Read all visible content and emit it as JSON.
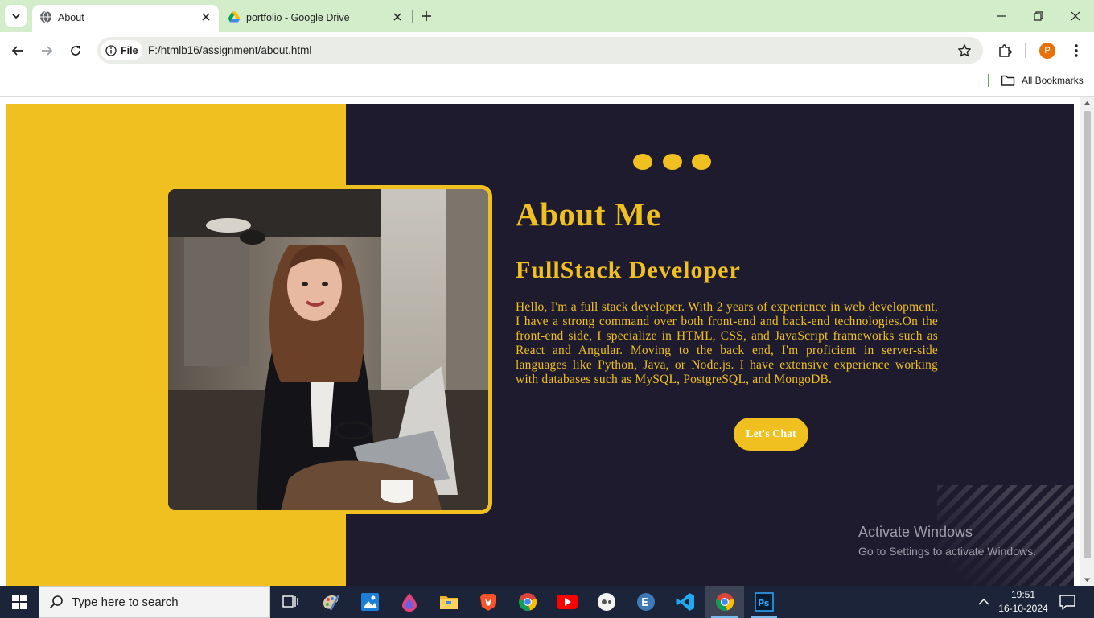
{
  "browser": {
    "tabs": [
      {
        "title": "About",
        "active": true
      },
      {
        "title": "portfolio - Google Drive",
        "active": false
      }
    ],
    "address": {
      "security_chip": "File",
      "url": "F:/htmlb16/assignment/about.html"
    },
    "profile_initial": "P",
    "bookmarks_label": "All Bookmarks"
  },
  "page": {
    "heading": "About Me",
    "subheading": "FullStack Developer",
    "paragraph": "Hello, I'm a full stack developer. With 2 years of experience in web development, I have a strong command over both front-end and back-end technologies.On the front-end side, I specialize in HTML, CSS, and JavaScript frameworks such as React and Angular. Moving to the back end, I'm proficient in server-side languages like Python, Java, or Node.js. I have extensive experience working with databases such as MySQL, PostgreSQL, and MongoDB.",
    "cta_label": "Let's Chat",
    "accent_color": "#f0c020",
    "background_color": "#1e1b2e"
  },
  "watermark": {
    "line1": "Activate Windows",
    "line2": "Go to Settings to activate Windows."
  },
  "taskbar": {
    "search_placeholder": "Type here to search",
    "apps": [
      "task-view-icon",
      "paint-icon",
      "photos-icon",
      "paint3d-icon",
      "file-explorer-icon",
      "brave-icon",
      "chrome-icon",
      "youtube-icon",
      "ms-teams-icon",
      "edge-icon",
      "vscode-icon",
      "chrome-icon",
      "photoshop-icon"
    ],
    "time": "19:51",
    "date": "16-10-2024"
  }
}
